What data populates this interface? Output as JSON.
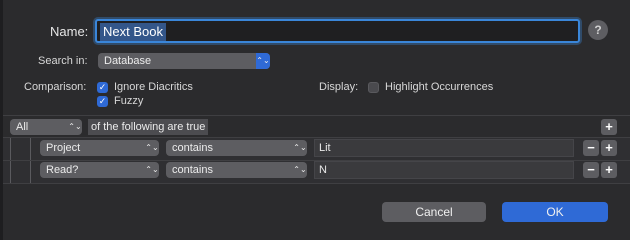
{
  "name": {
    "label": "Name:",
    "value": "Next Book",
    "help": "?"
  },
  "search": {
    "label": "Search in:",
    "value": "Database"
  },
  "comparison": {
    "label": "Comparison:",
    "options": [
      {
        "label": "Ignore Diacritics",
        "checked": true
      },
      {
        "label": "Fuzzy",
        "checked": true
      }
    ]
  },
  "display": {
    "label": "Display:",
    "option": {
      "label": "Highlight Occurrences",
      "checked": false
    }
  },
  "criteria": {
    "match": "All",
    "suffix": "of the following are true",
    "add": "+",
    "rows": [
      {
        "field": "Project",
        "operator": "contains",
        "value": "Lit",
        "remove": "−",
        "add": "+"
      },
      {
        "field": "Read?",
        "operator": "contains",
        "value": "N",
        "remove": "−",
        "add": "+"
      }
    ]
  },
  "buttons": {
    "cancel": "Cancel",
    "ok": "OK"
  },
  "colors": {
    "accent": "#2f6ad6",
    "focus_ring": "#3a86d9",
    "background": "#2b2b2d"
  }
}
